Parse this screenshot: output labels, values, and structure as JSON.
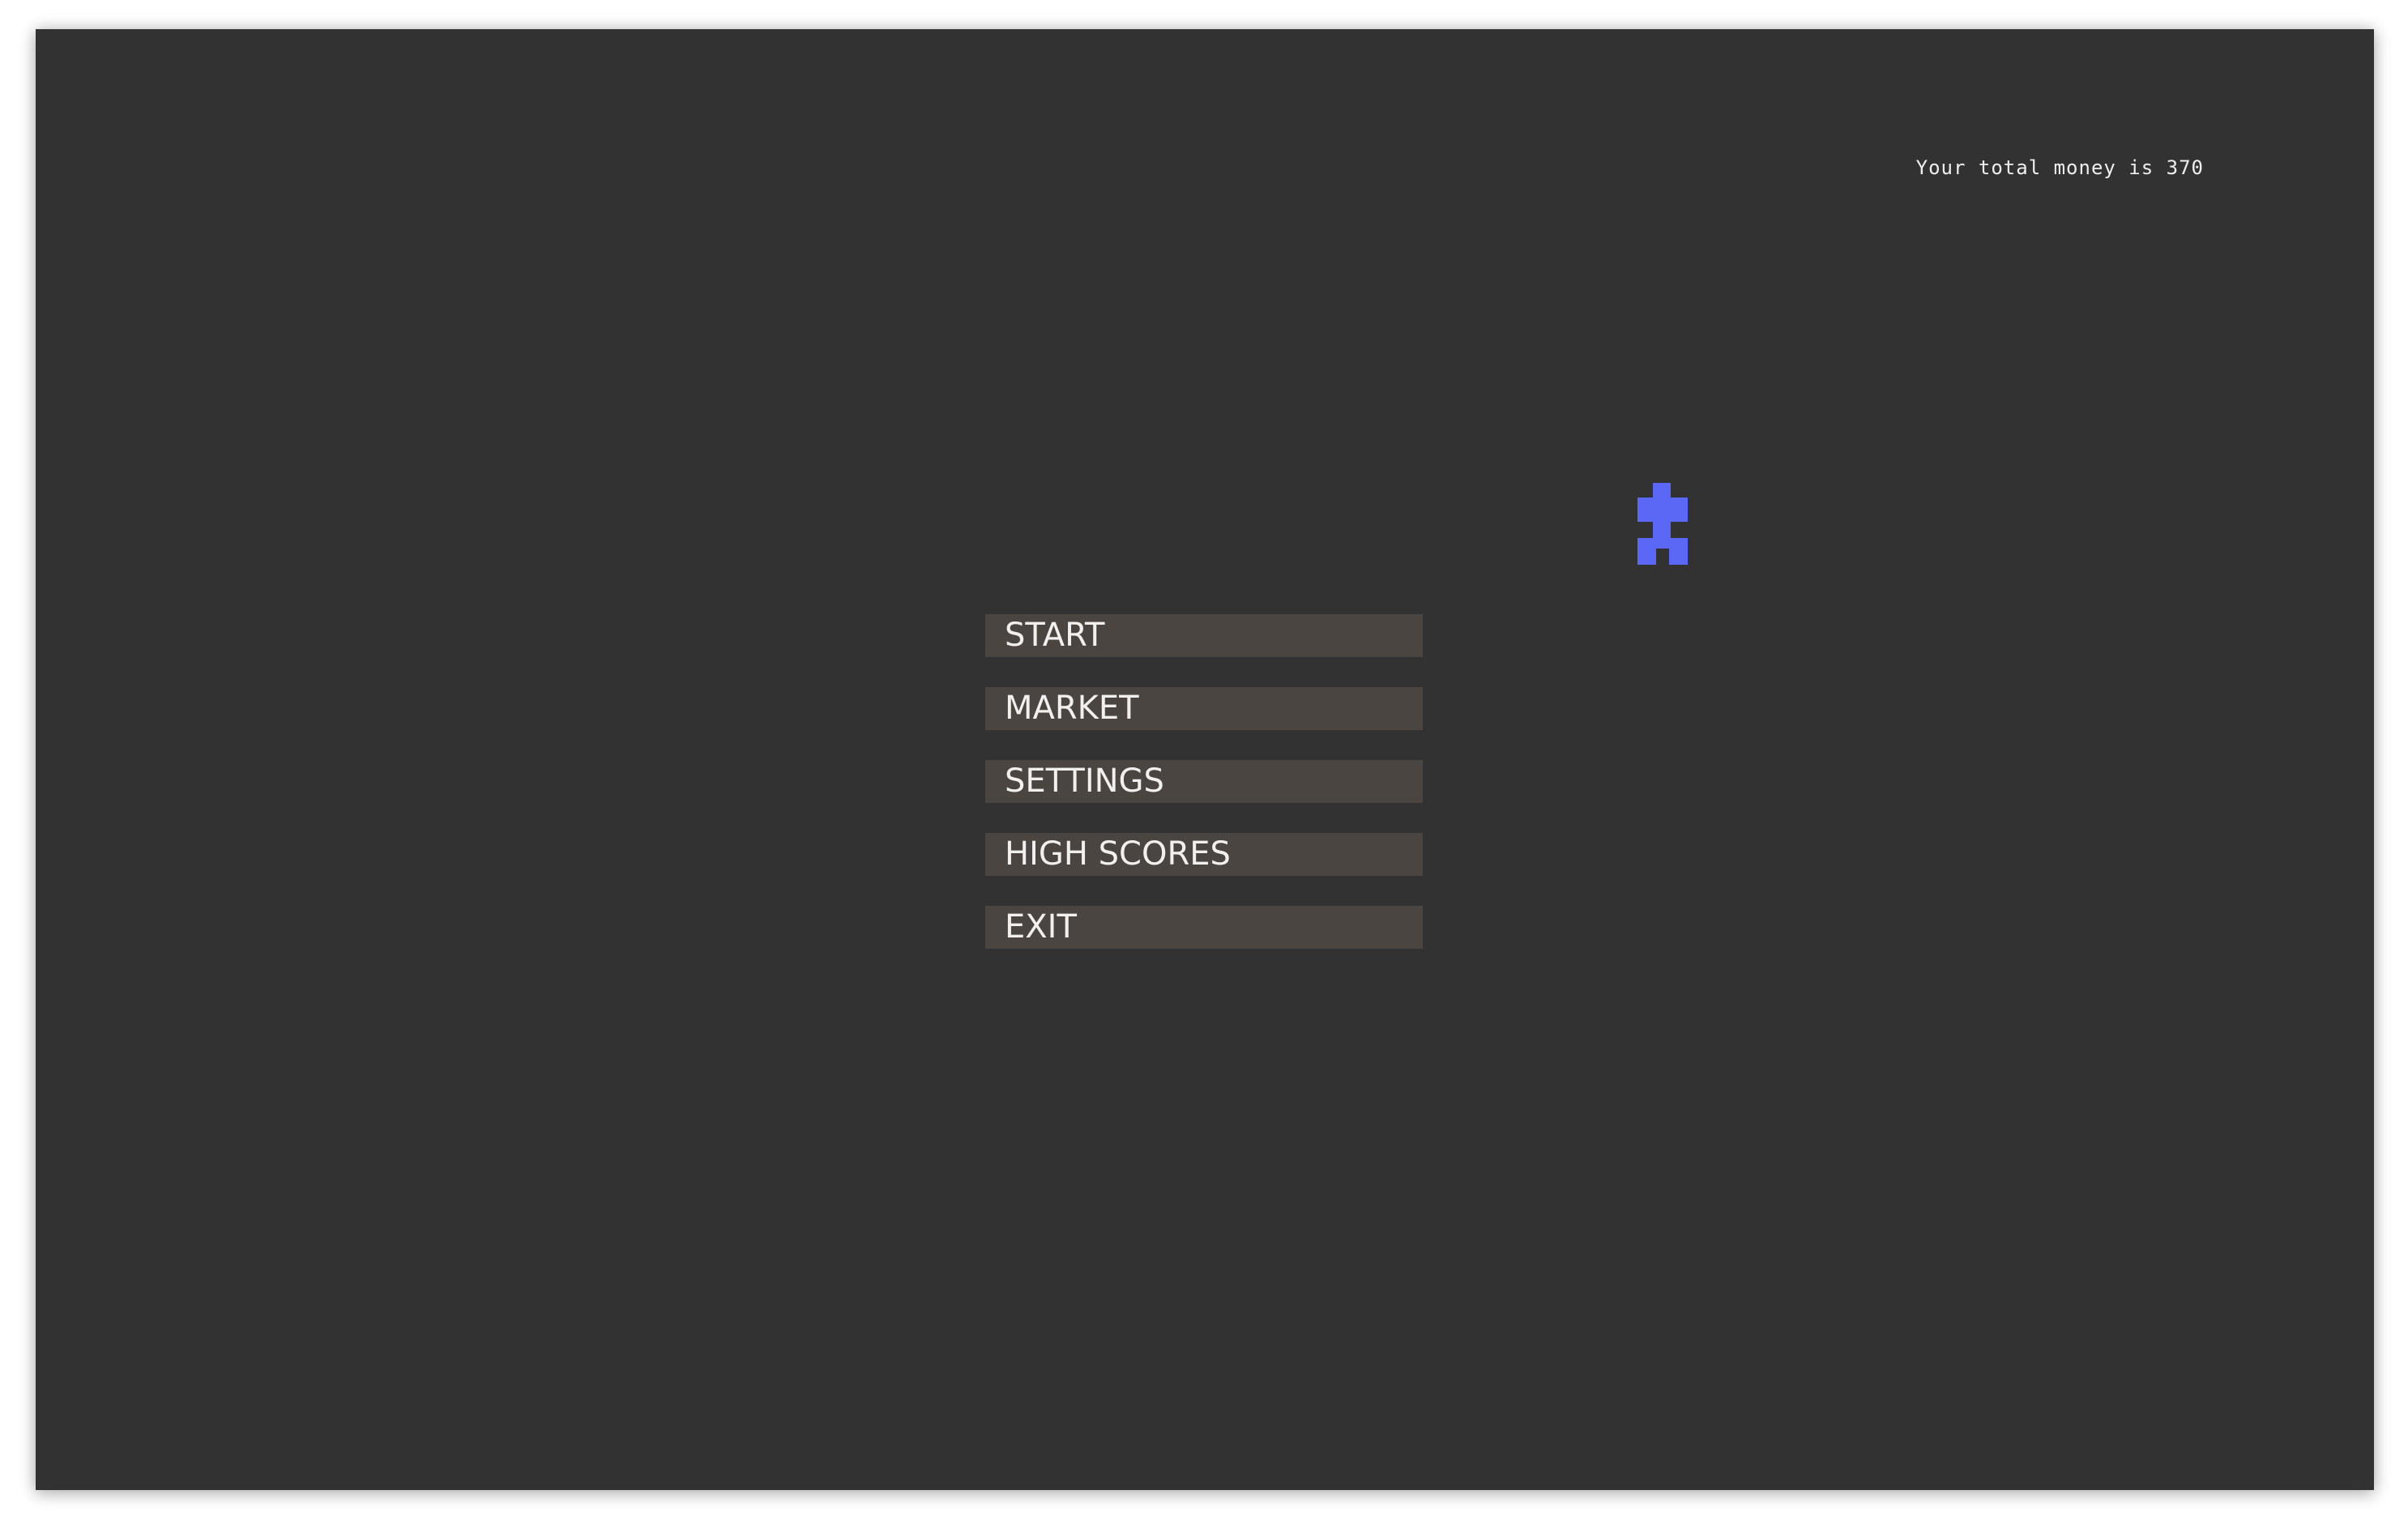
{
  "hud": {
    "money_text": "Your total money is 370"
  },
  "sprite": {
    "icon": "puzzle-piece-icon",
    "color": "#5a68f5"
  },
  "menu": {
    "start_label": "START",
    "market_label": "MARKET",
    "settings_label": "SETTINGS",
    "high_scores_label": "HIGH SCORES",
    "exit_label": "EXIT"
  }
}
